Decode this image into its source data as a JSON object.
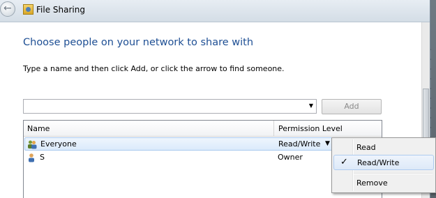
{
  "window": {
    "title": "File Sharing",
    "title_icon": "file-sharing-icon",
    "back_icon": "back-arrow-icon"
  },
  "main": {
    "heading": "Choose people on your network to share with",
    "instruction": "Type a name and then click Add, or click the arrow to find someone.",
    "name_input": {
      "value": "",
      "placeholder": ""
    },
    "add_button_label": "Add"
  },
  "grid": {
    "columns": [
      "Name",
      "Permission Level"
    ],
    "rows": [
      {
        "name": "Everyone",
        "permission": "Read/Write",
        "icon": "group-users-icon",
        "selected": true
      },
      {
        "name": "S",
        "permission": "Owner",
        "icon": "user-icon",
        "selected": false
      }
    ]
  },
  "context_menu": {
    "items": [
      {
        "label": "Read",
        "checked": false
      },
      {
        "label": "Read/Write",
        "checked": true
      },
      {
        "label": "Remove",
        "checked": false
      }
    ]
  },
  "colors": {
    "heading": "#1e4f94",
    "selection": "#dbeafb",
    "disabled_text": "#8a8a8a"
  }
}
